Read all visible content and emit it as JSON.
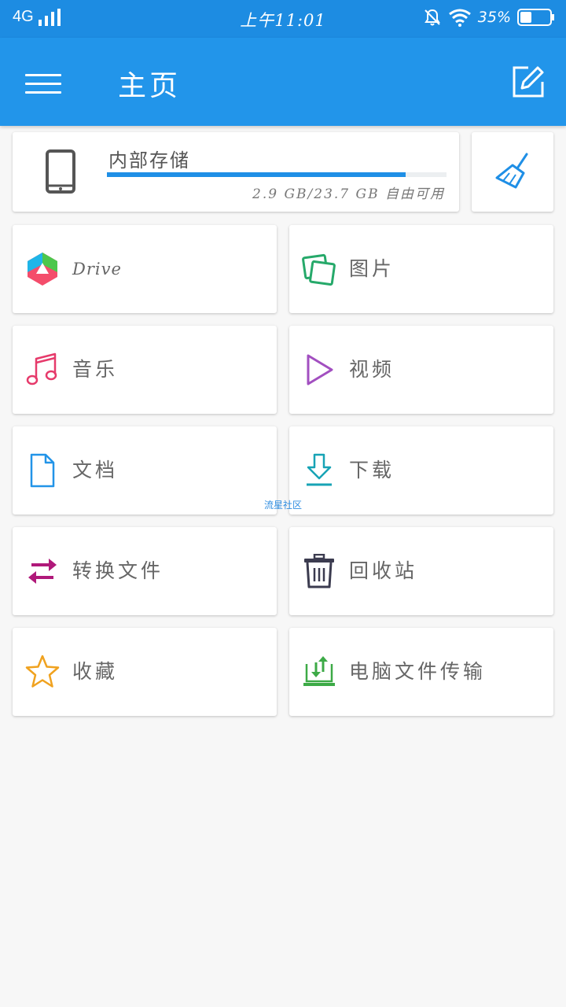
{
  "status_bar": {
    "network": "4G",
    "time": "上午11:01",
    "battery": "35%"
  },
  "app_bar": {
    "title": "主页",
    "menu_icon": "hamburger-menu-icon",
    "action_icon": "edit-icon"
  },
  "storage": {
    "title": "内部存储",
    "info": "2.9 GB/23.7 GB 自由可用",
    "used_fraction": 0.88,
    "icon": "phone-icon",
    "clean_icon": "broom-icon"
  },
  "tiles": [
    {
      "label": "Drive",
      "icon": "drive-icon"
    },
    {
      "label": "图片",
      "icon": "pictures-icon"
    },
    {
      "label": "音乐",
      "icon": "music-icon"
    },
    {
      "label": "视频",
      "icon": "video-icon"
    },
    {
      "label": "文档",
      "icon": "document-icon"
    },
    {
      "label": "下载",
      "icon": "download-icon"
    },
    {
      "label": "转换文件",
      "icon": "transfer-icon"
    },
    {
      "label": "回收站",
      "icon": "trash-icon"
    },
    {
      "label": "收藏",
      "icon": "star-icon"
    },
    {
      "label": "电脑文件传输",
      "icon": "pc-transfer-icon"
    }
  ],
  "watermark": "流星社区",
  "colors": {
    "status_bar": "#1d8ce2",
    "app_bar": "#2295ea",
    "accent": "#1f8fe6"
  }
}
